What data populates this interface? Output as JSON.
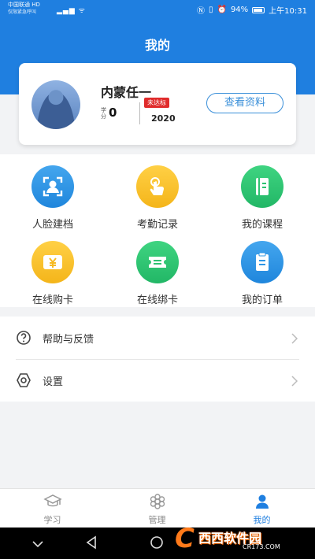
{
  "status_bar": {
    "carrier": "中国联通 HD",
    "carrier_sub": "仅限紧急呼叫",
    "battery": "94%",
    "time": "上午10:31"
  },
  "page": {
    "title": "我的"
  },
  "profile": {
    "name": "内蒙任一",
    "score_label": "学分",
    "score": "0",
    "badge": "未达标",
    "year": "2020",
    "view_button": "查看资料"
  },
  "grid": [
    {
      "label": "人脸建档",
      "icon": "face-scan-icon",
      "color": "#2f97e6"
    },
    {
      "label": "考勤记录",
      "icon": "touch-icon",
      "color": "#f6bb24"
    },
    {
      "label": "我的课程",
      "icon": "book-icon",
      "color": "#2dc271"
    },
    {
      "label": "在线购卡",
      "icon": "yuan-card-icon",
      "color": "#f6bb24"
    },
    {
      "label": "在线绑卡",
      "icon": "ticket-icon",
      "color": "#2dc271"
    },
    {
      "label": "我的订单",
      "icon": "order-icon",
      "color": "#2f97e6"
    }
  ],
  "menu": [
    {
      "label": "帮助与反馈",
      "icon": "help-icon"
    },
    {
      "label": "设置",
      "icon": "settings-icon"
    }
  ],
  "tabs": [
    {
      "label": "学习",
      "icon": "graduation-cap-icon",
      "active": false
    },
    {
      "label": "管理",
      "icon": "flower-icon",
      "active": false
    },
    {
      "label": "我的",
      "icon": "person-icon",
      "active": true
    }
  ],
  "colors": {
    "primary": "#1f7fe0",
    "badge": "#e02b2b"
  },
  "watermark": {
    "brand": "西西软件园",
    "domain": "CR173.COM"
  }
}
